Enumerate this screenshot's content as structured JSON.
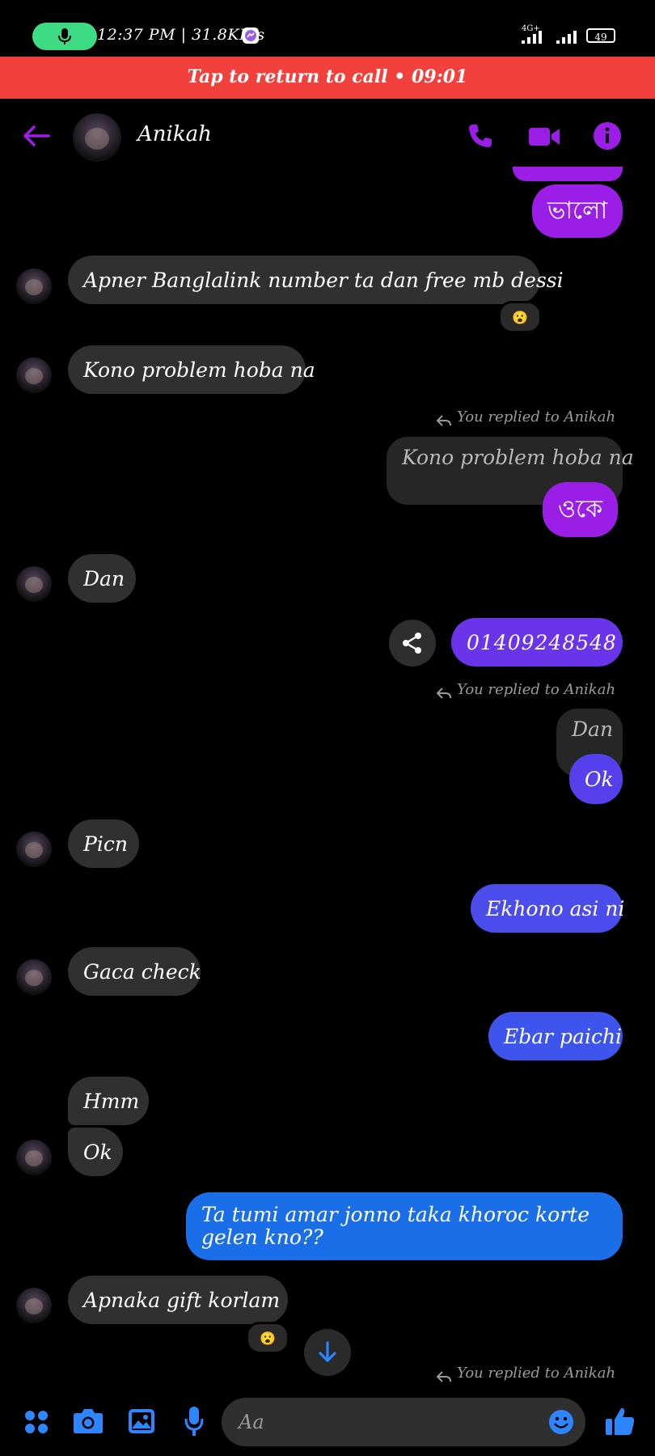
{
  "status_bar": {
    "time_speed": "12:37 PM | 31.8KB/s",
    "network": "4G+",
    "battery": "49"
  },
  "call_bar": {
    "label": "Tap to return to call • 09:01"
  },
  "header": {
    "contact_name": "Anikah"
  },
  "messages": {
    "m1": "ভালো",
    "m2": "Apner Banglalink number ta dan free mb dessi",
    "m2_reaction": "😮",
    "m3": "Kono problem hoba na",
    "r1": "You replied to Anikah",
    "q1": "Kono problem hoba na",
    "m4": "ওকে",
    "m5": "Dan",
    "m6": "01409248548",
    "r2": "You replied to Anikah",
    "q2": "Dan",
    "m7": "Ok",
    "m8": "Picn",
    "m9": "Ekhono asi ni",
    "m10": "Gaca check",
    "m11": "Ebar paichi",
    "m12": "Hmm",
    "m13": "Ok",
    "m14": "Ta tumi amar jonno taka khoroc korte gelen kno??",
    "m15": "Apnaka gift korlam",
    "m15_reaction": "😮",
    "r3": "You replied to Anikah"
  },
  "composer": {
    "placeholder": "Aa"
  },
  "colors": {
    "accent": "#9b1ee6",
    "call_bar": "#f2403c",
    "incoming": "#303030",
    "blue_bubble": "#1a6fe8"
  }
}
